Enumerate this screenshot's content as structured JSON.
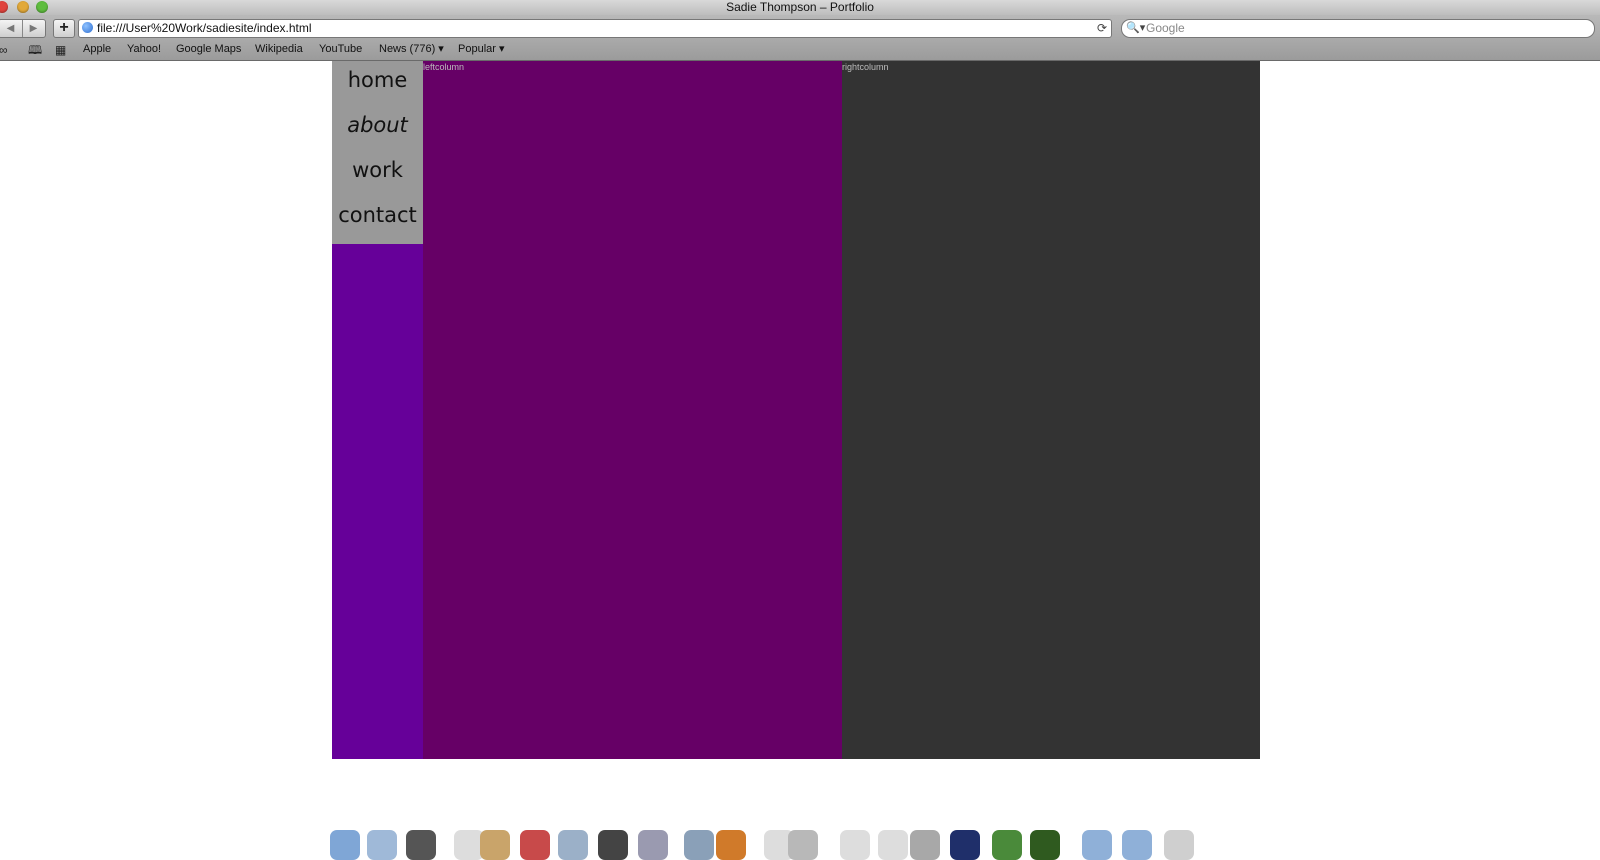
{
  "window": {
    "title": "Sadie Thompson – Portfolio"
  },
  "toolbar": {
    "back_icon": "back-arrow-icon",
    "forward_icon": "forward-arrow-icon",
    "add_label": "+",
    "url": "file:///User%20Work/sadiesite/index.html",
    "reload_glyph": "⟳",
    "search_placeholder": "Google"
  },
  "bookmarks": {
    "items": [
      "Apple",
      "Yahoo!",
      "Google Maps",
      "Wikipedia",
      "YouTube",
      "News (776) ▾",
      "Popular ▾"
    ]
  },
  "site": {
    "nav": [
      {
        "label": "home"
      },
      {
        "label": "about"
      },
      {
        "label": "work"
      },
      {
        "label": "contact"
      }
    ],
    "left_column_label": "leftcolumn",
    "right_column_label": "rightcolumn",
    "colors": {
      "nav_bg": "#999999",
      "nav_fill": "#660099",
      "left_column": "#660066",
      "right_column": "#333333"
    }
  },
  "dock": {
    "icons": [
      "finder-icon",
      "safari-icon",
      "time-machine-icon",
      "unknown-app-icon",
      "address-book-icon",
      "calendar-icon",
      "preview-icon",
      "imovie-icon",
      "system-preferences-icon",
      "xcode-icon",
      "firefox-icon",
      "unknown-app-icon",
      "display-icon",
      "unknown-app-icon",
      "unknown-app-icon",
      "script-editor-icon",
      "photoshop-icon",
      "image-app-icon",
      "dreamweaver-icon",
      "folder-icon",
      "folder-icon",
      "trash-icon"
    ]
  }
}
